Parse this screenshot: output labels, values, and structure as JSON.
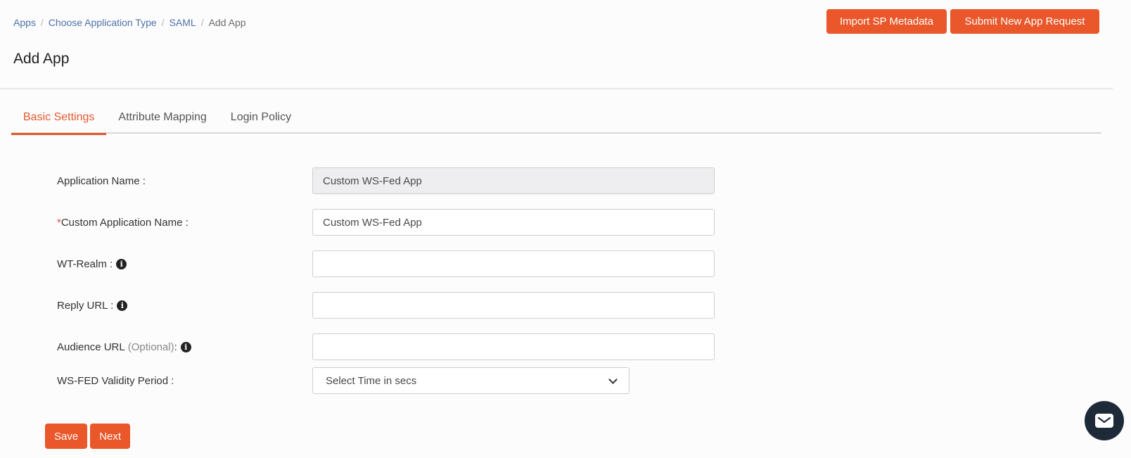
{
  "breadcrumb": {
    "items": [
      "Apps",
      "Choose Application Type",
      "SAML"
    ],
    "current": "Add App",
    "separator": "/"
  },
  "header": {
    "title": "Add App",
    "import_button": "Import SP Metadata",
    "submit_button": "Submit New App Request"
  },
  "tabs": [
    {
      "label": "Basic Settings",
      "active": true
    },
    {
      "label": "Attribute Mapping",
      "active": false
    },
    {
      "label": "Login Policy",
      "active": false
    }
  ],
  "form": {
    "application_name": {
      "label": "Application Name :",
      "value": "Custom WS-Fed App"
    },
    "custom_application_name": {
      "required_mark": "*",
      "label": "Custom Application Name :",
      "value": "Custom WS-Fed App"
    },
    "wt_realm": {
      "label": "WT-Realm :",
      "value": ""
    },
    "reply_url": {
      "label": "Reply URL :",
      "value": ""
    },
    "audience_url": {
      "label": "Audience URL",
      "optional": "(Optional)",
      "suffix": " :",
      "value": ""
    },
    "validity_period": {
      "label": "WS-FED Validity Period :",
      "selected": "Select Time in secs"
    }
  },
  "actions": {
    "save": "Save",
    "next": "Next"
  },
  "icons": {
    "info": "info-circle-icon",
    "chat": "mail-icon"
  },
  "colors": {
    "accent": "#e9572a",
    "link": "#4a72a8",
    "fab": "#1e2a38"
  }
}
